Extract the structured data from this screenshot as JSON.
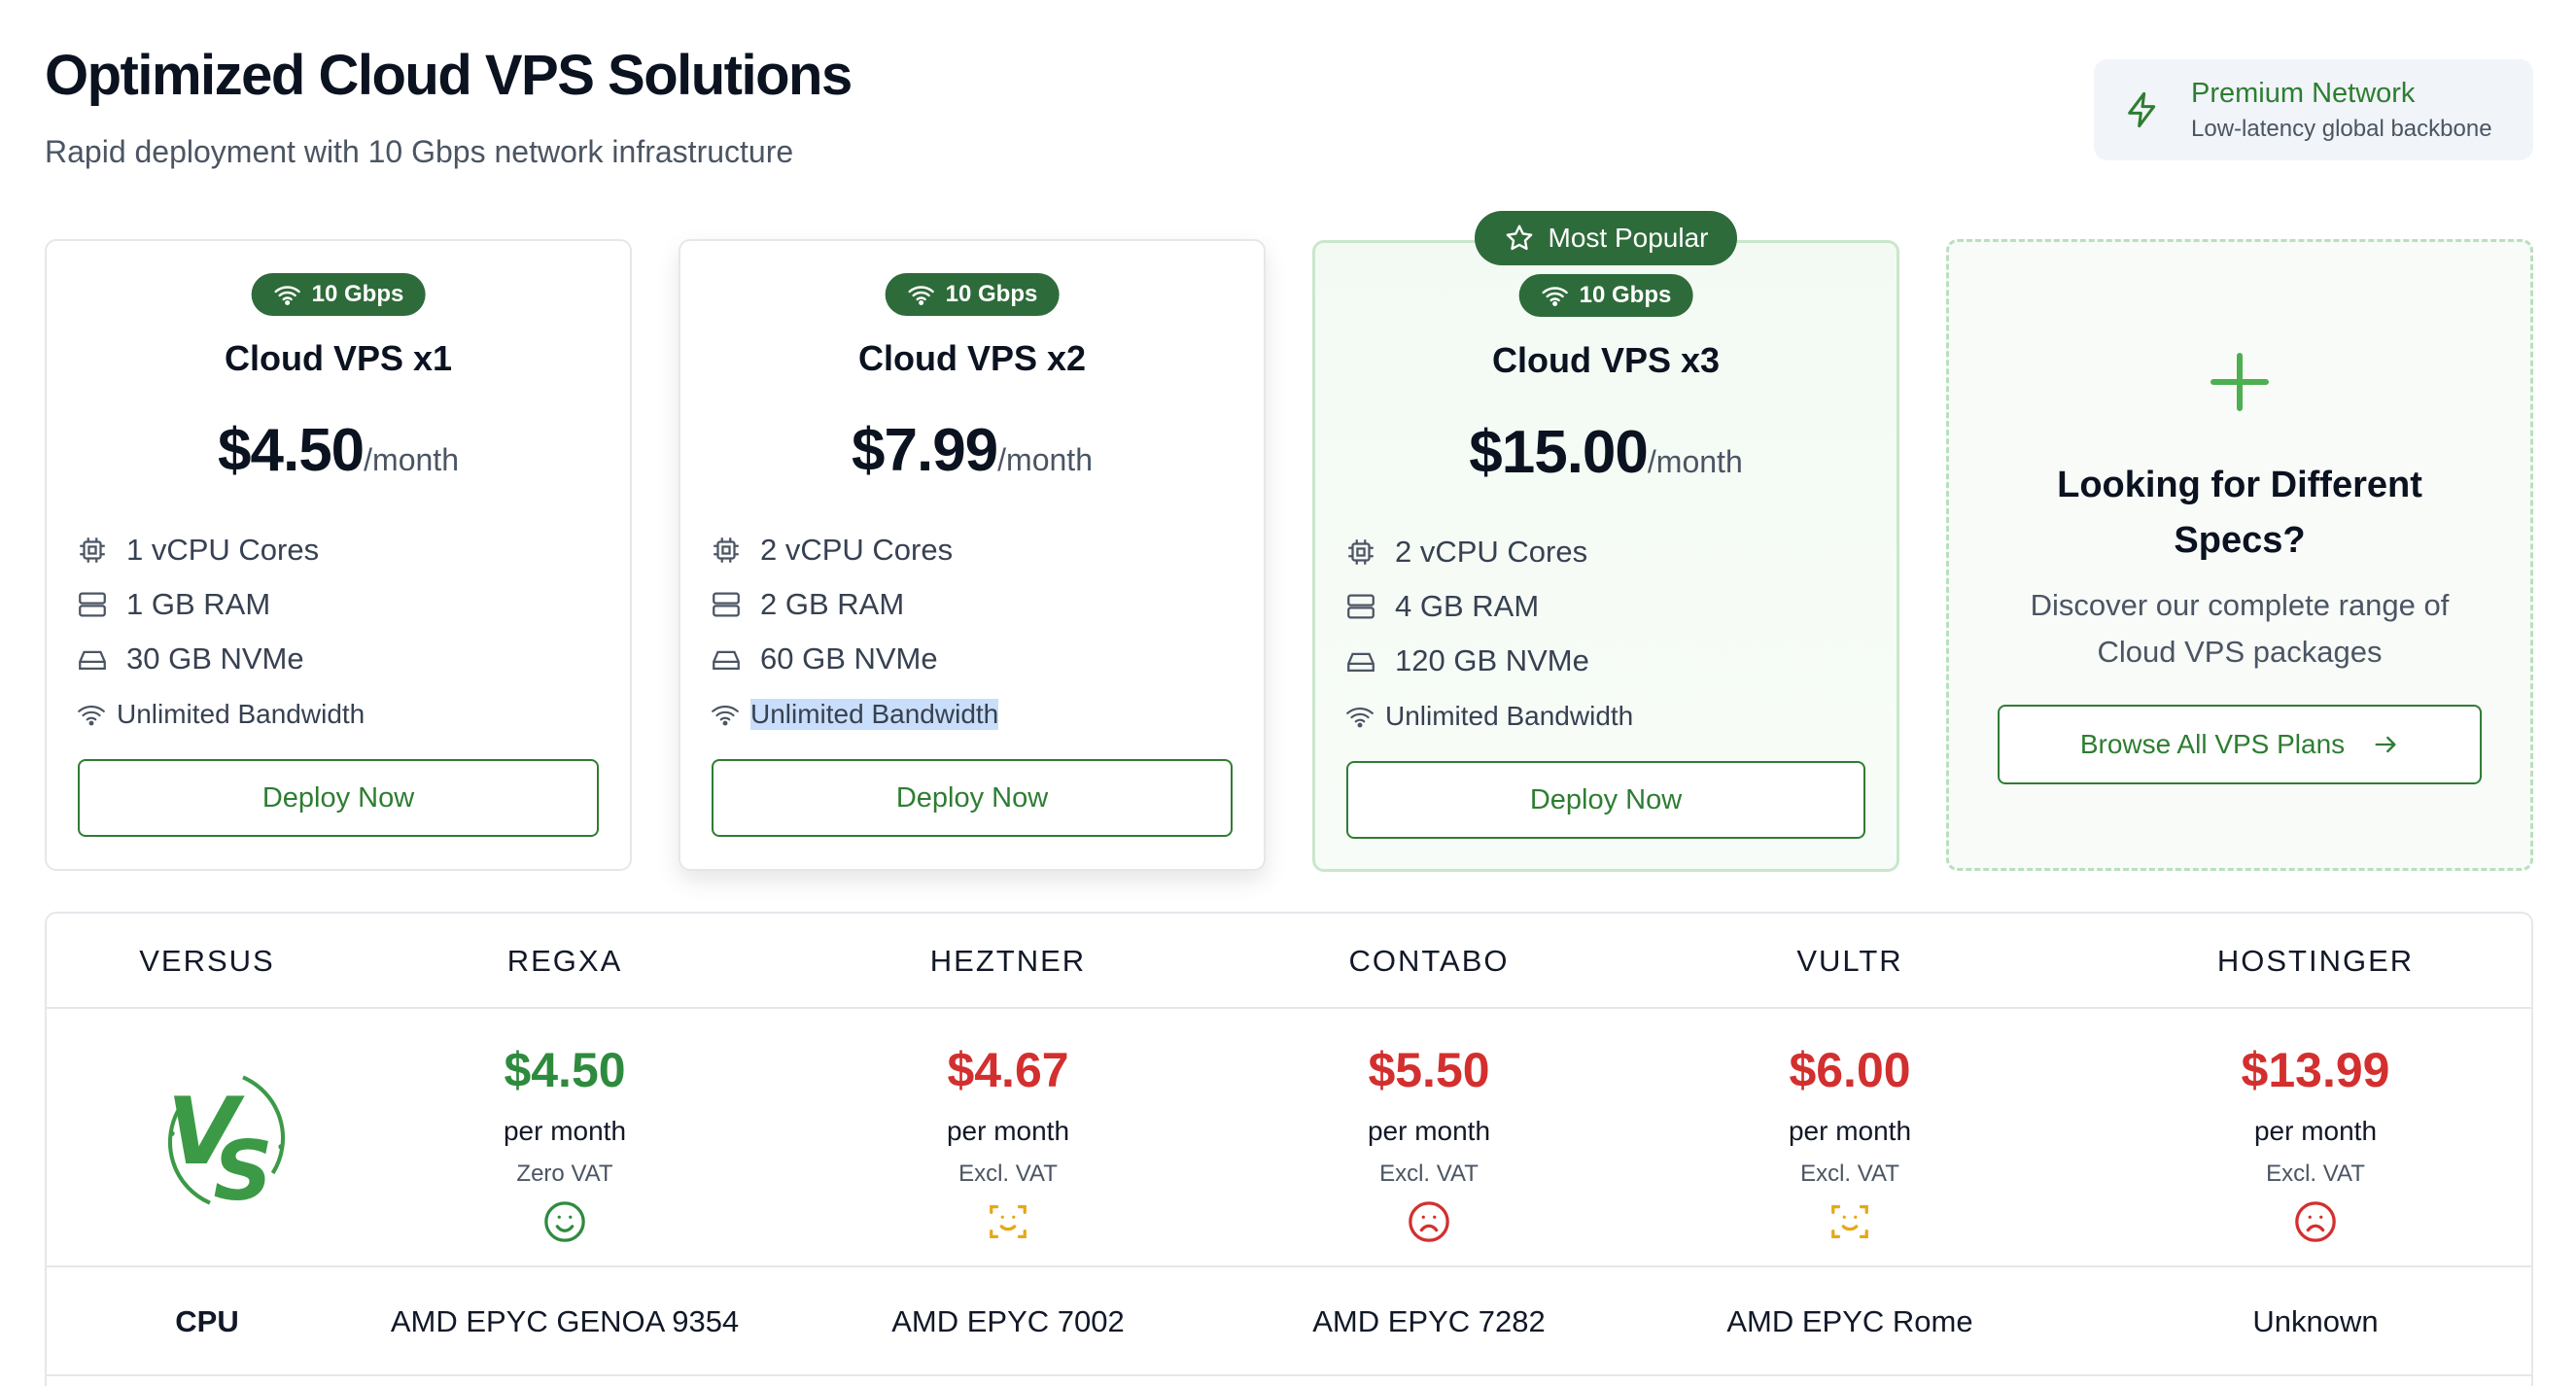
{
  "header": {
    "title": "Optimized Cloud VPS Solutions",
    "subtitle": "Rapid deployment with 10 Gbps network infrastructure",
    "network_title": "Premium Network",
    "network_sub": "Low-latency global backbone"
  },
  "popular_label": "Most Popular",
  "plans": [
    {
      "badge": "10 Gbps",
      "name": "Cloud VPS x1",
      "price": "$4.50",
      "period": "/month",
      "cpu": "1 vCPU Cores",
      "ram": "1 GB RAM",
      "disk": "30 GB NVMe",
      "bandwidth": "Unlimited Bandwidth",
      "cta": "Deploy Now"
    },
    {
      "badge": "10 Gbps",
      "name": "Cloud VPS x2",
      "price": "$7.99",
      "period": "/month",
      "cpu": "2 vCPU Cores",
      "ram": "2 GB RAM",
      "disk": "60 GB NVMe",
      "bandwidth": "Unlimited Bandwidth",
      "cta": "Deploy Now"
    },
    {
      "badge": "10 Gbps",
      "name": "Cloud VPS x3",
      "price": "$15.00",
      "period": "/month",
      "cpu": "2 vCPU Cores",
      "ram": "4 GB RAM",
      "disk": "120 GB NVMe",
      "bandwidth": "Unlimited Bandwidth",
      "cta": "Deploy Now"
    }
  ],
  "custom": {
    "title": "Looking for Different Specs?",
    "description": "Discover our complete range of Cloud VPS packages",
    "cta": "Browse All VPS Plans"
  },
  "comparison": {
    "headers": [
      "VERSUS",
      "REGXA",
      "HEZTNER",
      "CONTABO",
      "VULTR",
      "HOSTINGER"
    ],
    "per_month": "per month",
    "providers": [
      {
        "price": "$4.50",
        "tax": "Zero VAT",
        "mood": "happy",
        "color": "#2e8b3e"
      },
      {
        "price": "$4.67",
        "tax": "Excl. VAT",
        "mood": "neutral",
        "color": "#d32f2f"
      },
      {
        "price": "$5.50",
        "tax": "Excl. VAT",
        "mood": "sad",
        "color": "#d32f2f"
      },
      {
        "price": "$6.00",
        "tax": "Excl. VAT",
        "mood": "neutral",
        "color": "#d32f2f"
      },
      {
        "price": "$13.99",
        "tax": "Excl. VAT",
        "mood": "sad",
        "color": "#d32f2f"
      }
    ],
    "cpu_label": "CPU",
    "cpu_values": [
      "AMD EPYC GENOA 9354",
      "AMD EPYC 7002",
      "AMD EPYC 7282",
      "AMD EPYC Rome",
      "Unknown"
    ]
  },
  "colors": {
    "accent": "#2e7d32",
    "badge": "#2e6b3a",
    "bad": "#d32f2f",
    "neutral_face": "#e6a817"
  }
}
